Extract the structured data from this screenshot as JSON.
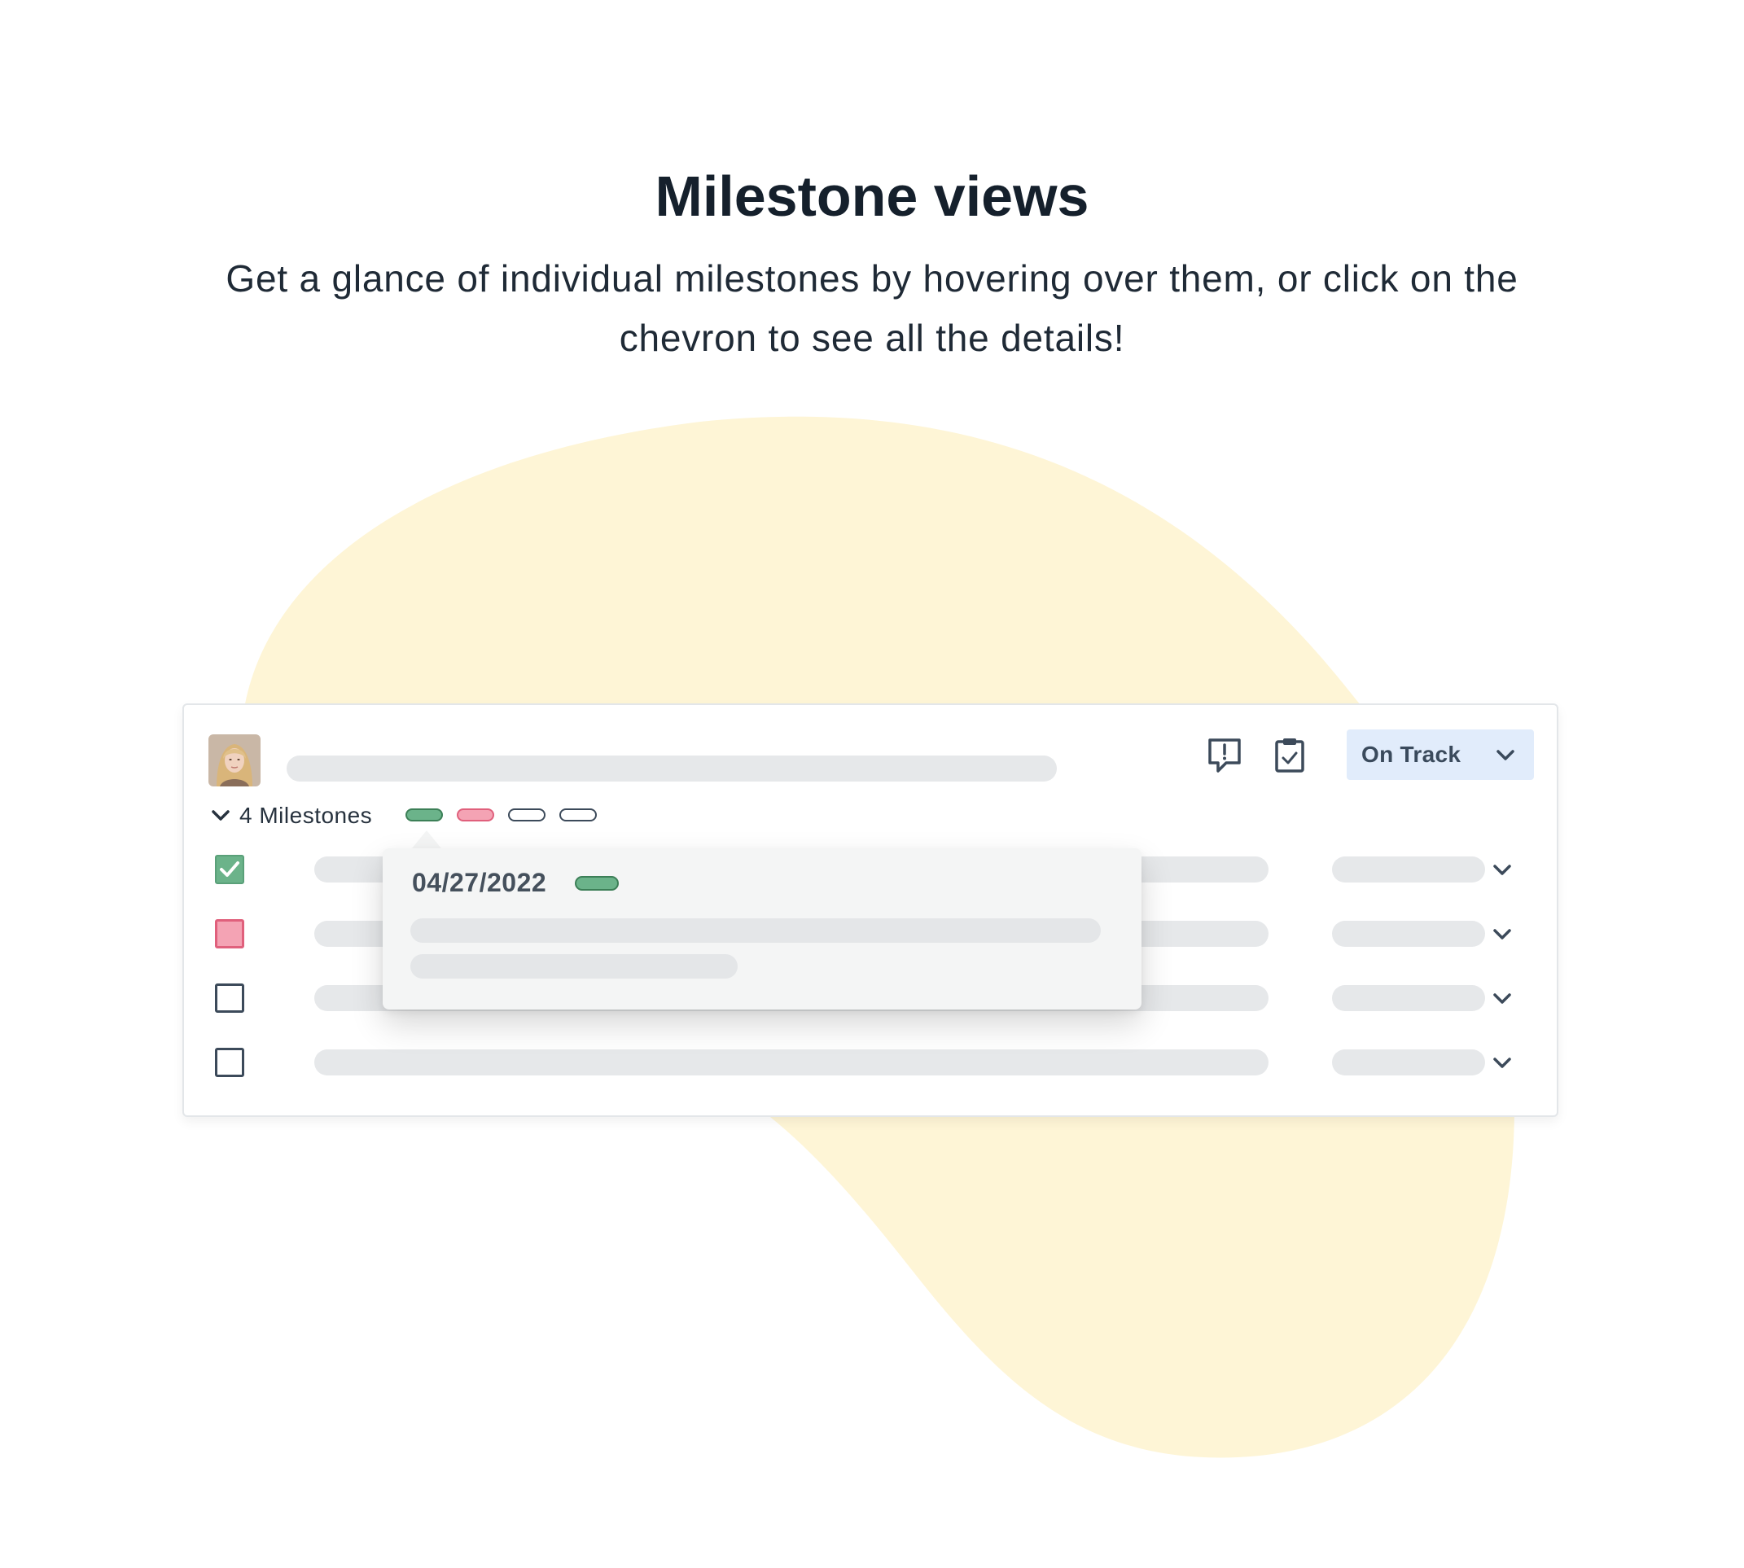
{
  "header": {
    "title": "Milestone views",
    "subtitle": "Get a glance of individual milestones by hovering over them, or click on the chevron to see all the details!"
  },
  "card": {
    "status": {
      "label": "On Track"
    },
    "milestones_toggle": {
      "label": "4 Milestones"
    },
    "milestone_pills": [
      "complete",
      "overdue",
      "pending",
      "pending"
    ],
    "rows": [
      {
        "state": "checked"
      },
      {
        "state": "overdue"
      },
      {
        "state": "unchecked"
      },
      {
        "state": "unchecked"
      }
    ]
  },
  "tooltip": {
    "date": "04/27/2022",
    "status": "complete"
  },
  "colors": {
    "background_blob": "#fef5d6",
    "complete_green": "#6bb38a",
    "complete_green_border": "#3c7f57",
    "overdue_pink": "#f4a3b4",
    "overdue_pink_border": "#e0607c",
    "status_bg": "#e1ecfb",
    "skeleton": "#e6e8ea",
    "text_dark": "#15202c"
  },
  "icons": {
    "comment": "comment-alert-icon",
    "clipboard": "clipboard-check-icon",
    "chevron": "chevron-down-icon"
  }
}
